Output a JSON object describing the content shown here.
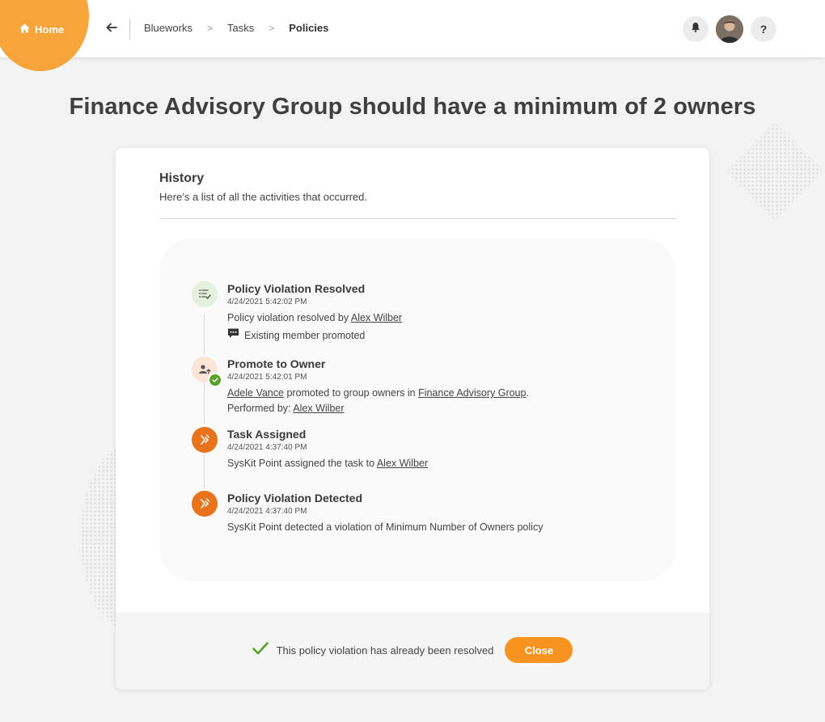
{
  "header": {
    "home_label": "Home",
    "breadcrumb": [
      "Blueworks",
      "Tasks",
      "Policies"
    ],
    "breadcrumb_separator": ">"
  },
  "page": {
    "title": "Finance Advisory Group should have a minimum of 2 owners"
  },
  "history": {
    "title": "History",
    "subtitle": "Here’s a list of all the activities that occurred.",
    "events": [
      {
        "icon": "policy-resolved-icon",
        "title": "Policy Violation Resolved",
        "time": "4/24/2021 5:42:02 PM",
        "desc_prefix": "Policy violation resolved by",
        "desc_link": "Alex Wilber",
        "comment": "Existing member promoted"
      },
      {
        "icon": "promote-user-icon",
        "title": "Promote to Owner",
        "time": "4/24/2021 5:42:01 PM",
        "user_link": "Adele Vance",
        "desc_middle": "promoted to group owners in",
        "group_link": "Finance Advisory Group",
        "desc_end": ".",
        "performed_prefix": "Performed by:",
        "performed_link": "Alex Wilber"
      },
      {
        "icon": "task-assigned-icon",
        "title": "Task Assigned",
        "time": "4/24/2021 4:37:40 PM",
        "desc_prefix": "SysKit Point assigned the task to",
        "desc_link": "Alex Wilber"
      },
      {
        "icon": "violation-detected-icon",
        "title": "Policy Violation Detected",
        "time": "4/24/2021 4:37:40 PM",
        "desc": "SysKit Point detected a violation of Minimum Number of Owners policy"
      }
    ]
  },
  "footer": {
    "resolved_text": "This policy violation has already been resolved",
    "close_label": "Close"
  },
  "colors": {
    "accent": "#f7931e",
    "home_blob": "#f7a43b",
    "icon_orange": "#e8731a",
    "success_green": "#5aa12a"
  }
}
